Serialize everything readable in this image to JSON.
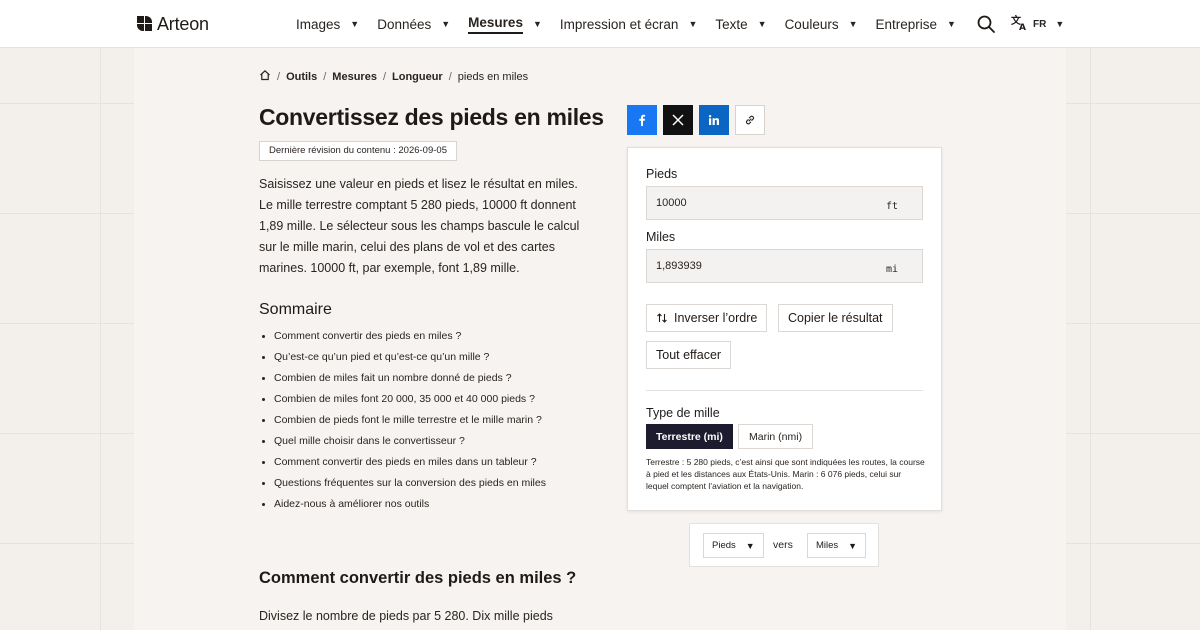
{
  "header": {
    "brand": "Arteon",
    "nav": [
      {
        "label": "Images",
        "active": false
      },
      {
        "label": "Données",
        "active": false
      },
      {
        "label": "Mesures",
        "active": true
      },
      {
        "label": "Impression et écran",
        "active": false
      },
      {
        "label": "Texte",
        "active": false
      },
      {
        "label": "Couleurs",
        "active": false
      },
      {
        "label": "Entreprise",
        "active": false
      }
    ],
    "lang": "FR"
  },
  "breadcrumb": {
    "items": [
      "Outils",
      "Mesures",
      "Longueur"
    ],
    "current": "pieds en miles"
  },
  "article": {
    "title": "Convertissez des pieds en miles",
    "revision": "Dernière révision du contenu : 2026-09-05",
    "intro": "Saisissez une valeur en pieds et lisez le résultat en miles. Le mille terrestre comptant 5 280 pieds, 10000 ft donnent 1,89 mille. Le sélecteur sous les champs bascule le calcul sur le mille marin, celui des plans de vol et des cartes marines. 10000 ft, par exemple, font 1,89 mille.",
    "toc_title": "Sommaire",
    "toc": [
      "Comment convertir des pieds en miles ?",
      "Qu’est-ce qu’un pied et qu’est-ce qu’un mille ?",
      "Combien de miles fait un nombre donné de pieds ?",
      "Combien de miles font 20 000, 35 000 et 40 000 pieds ?",
      "Combien de pieds font le mille terrestre et le mille marin ?",
      "Quel mille choisir dans le convertisseur ?",
      "Comment convertir des pieds en miles dans un tableur ?",
      "Questions fréquentes sur la conversion des pieds en miles",
      "Aidez-nous à améliorer nos outils"
    ],
    "h2": "Comment convertir des pieds en miles ?",
    "para2": "Divisez le nombre de pieds par 5 280. Dix mille pieds"
  },
  "converter": {
    "from_label": "Pieds",
    "from_value": "10000",
    "from_unit": "ft",
    "to_label": "Miles",
    "to_value": "1,893939",
    "to_unit": "mi",
    "swap_label": "Inverser l’ordre",
    "copy_label": "Copier le résultat",
    "clear_label": "Tout effacer",
    "mile_type_label": "Type de mille",
    "mile_types": [
      "Terrestre (mi)",
      "Marin (nmi)"
    ],
    "selected_mile_type": "Terrestre (mi)",
    "note": "Terrestre : 5 280 pieds, c’est ainsi que sont indiquées les routes, la course à pied et les distances aux États-Unis. Marin : 6 076 pieds, celui sur lequel comptent l’aviation et la navigation."
  },
  "unit_pair": {
    "from": "Pieds",
    "connector": "vers",
    "to": "Miles"
  },
  "colors": {
    "facebook": "#1877f2",
    "x": "#111111",
    "linkedin": "#0a66c2",
    "selected_segment": "#1d1b2e"
  },
  "icons": [
    "home-icon",
    "search-icon",
    "translate-icon",
    "facebook-icon",
    "x-icon",
    "linkedin-icon",
    "link-icon",
    "swap-icon"
  ]
}
